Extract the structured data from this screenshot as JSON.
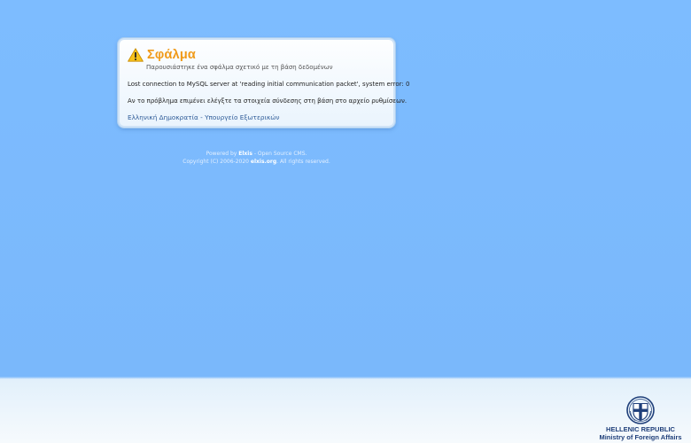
{
  "error": {
    "icon": "warning-icon",
    "title": "Σφάλμα",
    "subtitle": "Παρουσιάστηκε ένα σφάλμα σχετικό με τη βάση δεδομένων",
    "message": "Lost connection to MySQL server at 'reading initial communication packet', system error: 0",
    "hint": "Αν το πρόβλημα επιμένει ελέγξτε τα στοιχεία σύνδεσης στη βάση στο αρχείο ρυθμίσεων.",
    "link_text": "Ελληνική Δημοκρατία - Υπουργείο Εξωτερικών"
  },
  "footer": {
    "powered_prefix": "Powered by ",
    "powered_name": "Elxis",
    "powered_suffix": " - Open Source CMS.",
    "copyright_prefix": "Copyright (C) 2006-2020 ",
    "copyright_link": "elxis.org",
    "copyright_suffix": ". All rights reserved."
  },
  "ministry": {
    "icon": "greek-coat-of-arms-icon",
    "line1": "HELLENIC REPUBLIC",
    "line2": "Ministry of Foreign Affairs"
  },
  "colors": {
    "background": "#7dbcff",
    "title": "#f09a18",
    "link": "#2f5c98",
    "ministry_text": "#1f3f7a"
  }
}
